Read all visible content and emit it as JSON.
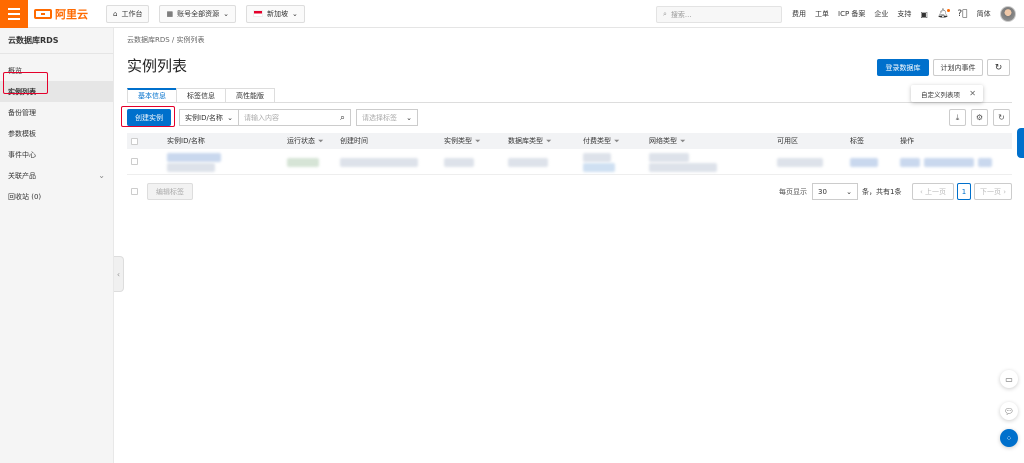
{
  "topbar": {
    "brand": "阿里云",
    "workbench": "工作台",
    "account_scope": "账号全部资源",
    "region": "新加坡",
    "search_placeholder": "搜索...",
    "links": [
      "费用",
      "工单",
      "ICP 备案",
      "企业",
      "支持"
    ],
    "language": "简体"
  },
  "sidebar": {
    "title": "云数据库RDS",
    "items": [
      {
        "label": "概览"
      },
      {
        "label": "实例列表"
      },
      {
        "label": "备份管理"
      },
      {
        "label": "参数模板"
      },
      {
        "label": "事件中心"
      },
      {
        "label": "关联产品"
      },
      {
        "label": "回收站 (0)"
      }
    ]
  },
  "main": {
    "breadcrumb": "云数据库RDS / 实例列表",
    "title": "实例列表",
    "actions": {
      "login_db": "登录数据库",
      "planned_events": "计划内事件"
    },
    "tabs": [
      "基本信息",
      "标签信息",
      "高性能版"
    ],
    "tooltip": "自定义列表项",
    "create_button": "创建实例",
    "filter_select": "实例ID/名称",
    "filter_input_placeholder": "请输入内容",
    "tag_select_placeholder": "请选择标签",
    "columns": [
      "实例ID/名称",
      "运行状态",
      "创建时间",
      "实例类型",
      "数据库类型",
      "付费类型",
      "网络类型",
      "可用区",
      "标签",
      "操作"
    ],
    "batch_tag_button": "编辑标签",
    "pager": {
      "per_page_label": "每页显示",
      "per_page": "30",
      "total_label": "条，共有1条",
      "prev": "上一页",
      "page": "1",
      "next": "下一页"
    }
  },
  "colors": {
    "accent": "#ff6a00",
    "primary": "#0070cc"
  }
}
